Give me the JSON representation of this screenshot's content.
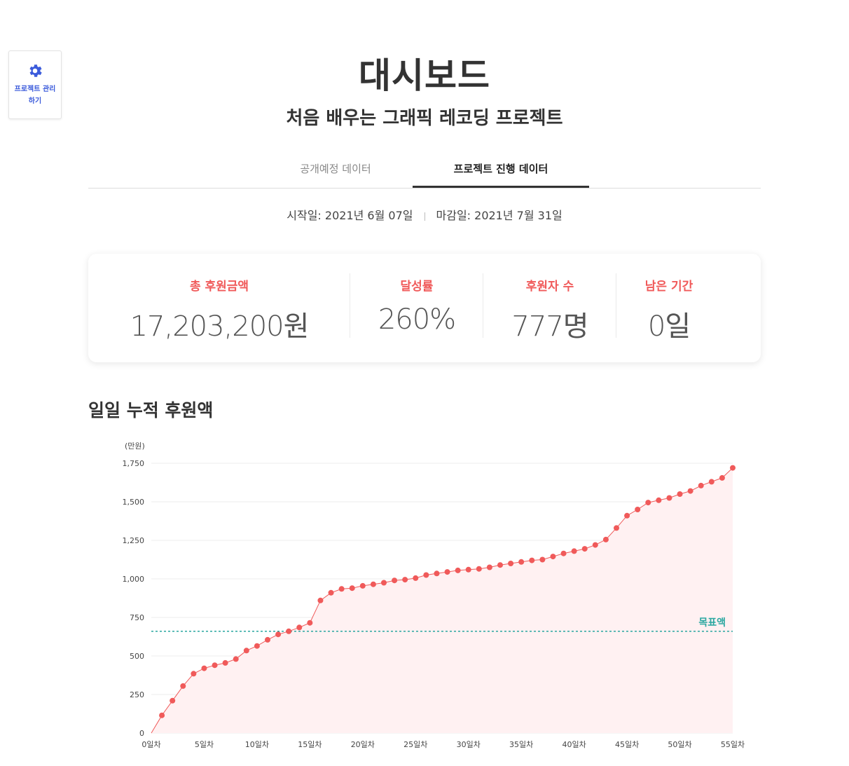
{
  "side_button": {
    "label": "프로젝트 관리하기",
    "icon": "gear-icon"
  },
  "header": {
    "title": "대시보드",
    "subtitle": "처음 배우는 그래픽 레코딩 프로젝트"
  },
  "tabs": [
    {
      "label": "공개예정 데이터",
      "active": false
    },
    {
      "label": "프로젝트 진행 데이터",
      "active": true
    }
  ],
  "dates": {
    "start": "시작일: 2021년 6월 07일",
    "end": "마감일: 2021년 7월 31일"
  },
  "stats": [
    {
      "label": "총 후원금액",
      "value": "17,203,200원"
    },
    {
      "label": "달성률",
      "value": "260%"
    },
    {
      "label": "후원자 수",
      "value": "777명"
    },
    {
      "label": "남은 기간",
      "value": "0일"
    }
  ],
  "section": {
    "title": "일일 누적 후원액"
  },
  "colors": {
    "accent": "#f05a5a",
    "goal_line": "#2aa7a0",
    "icon_blue": "#3b5bdb",
    "area_fill": "#fff1f2"
  },
  "chart_data": {
    "type": "area",
    "ylabel": "(만원)",
    "ylim": [
      0,
      1750
    ],
    "yticks": [
      0,
      250,
      500,
      750,
      1000,
      1250,
      1500,
      1750
    ],
    "ytick_labels": [
      "0",
      "250",
      "500",
      "750",
      "1,000",
      "1,250",
      "1,500",
      "1,750"
    ],
    "xlim": [
      0,
      55
    ],
    "xticks": [
      0,
      5,
      10,
      15,
      20,
      25,
      30,
      35,
      40,
      45,
      50,
      55
    ],
    "xtick_labels": [
      "0일차",
      "5일차",
      "10일차",
      "15일차",
      "20일차",
      "25일차",
      "30일차",
      "35일차",
      "40일차",
      "45일차",
      "50일차",
      "55일차"
    ],
    "grid": true,
    "goal": {
      "label": "목표액",
      "value": 660
    },
    "series": [
      {
        "x": [
          0,
          1,
          2,
          3,
          4,
          5,
          6,
          7,
          8,
          9,
          10,
          11,
          12,
          13,
          14,
          15,
          16,
          17,
          18,
          19,
          20,
          21,
          22,
          23,
          24,
          25,
          26,
          27,
          28,
          29,
          30,
          31,
          32,
          33,
          34,
          35,
          36,
          37,
          38,
          39,
          40,
          41,
          42,
          43,
          44,
          45,
          46,
          47,
          48,
          49,
          50,
          51,
          52,
          53,
          54,
          55
        ],
        "values": [
          0,
          115,
          210,
          305,
          385,
          420,
          440,
          455,
          480,
          535,
          565,
          605,
          640,
          660,
          685,
          715,
          860,
          910,
          935,
          940,
          955,
          965,
          975,
          990,
          995,
          1005,
          1025,
          1035,
          1045,
          1055,
          1060,
          1065,
          1075,
          1090,
          1100,
          1110,
          1120,
          1125,
          1145,
          1165,
          1180,
          1195,
          1220,
          1255,
          1330,
          1410,
          1450,
          1495,
          1510,
          1525,
          1550,
          1570,
          1605,
          1630,
          1655,
          1720
        ]
      }
    ]
  }
}
